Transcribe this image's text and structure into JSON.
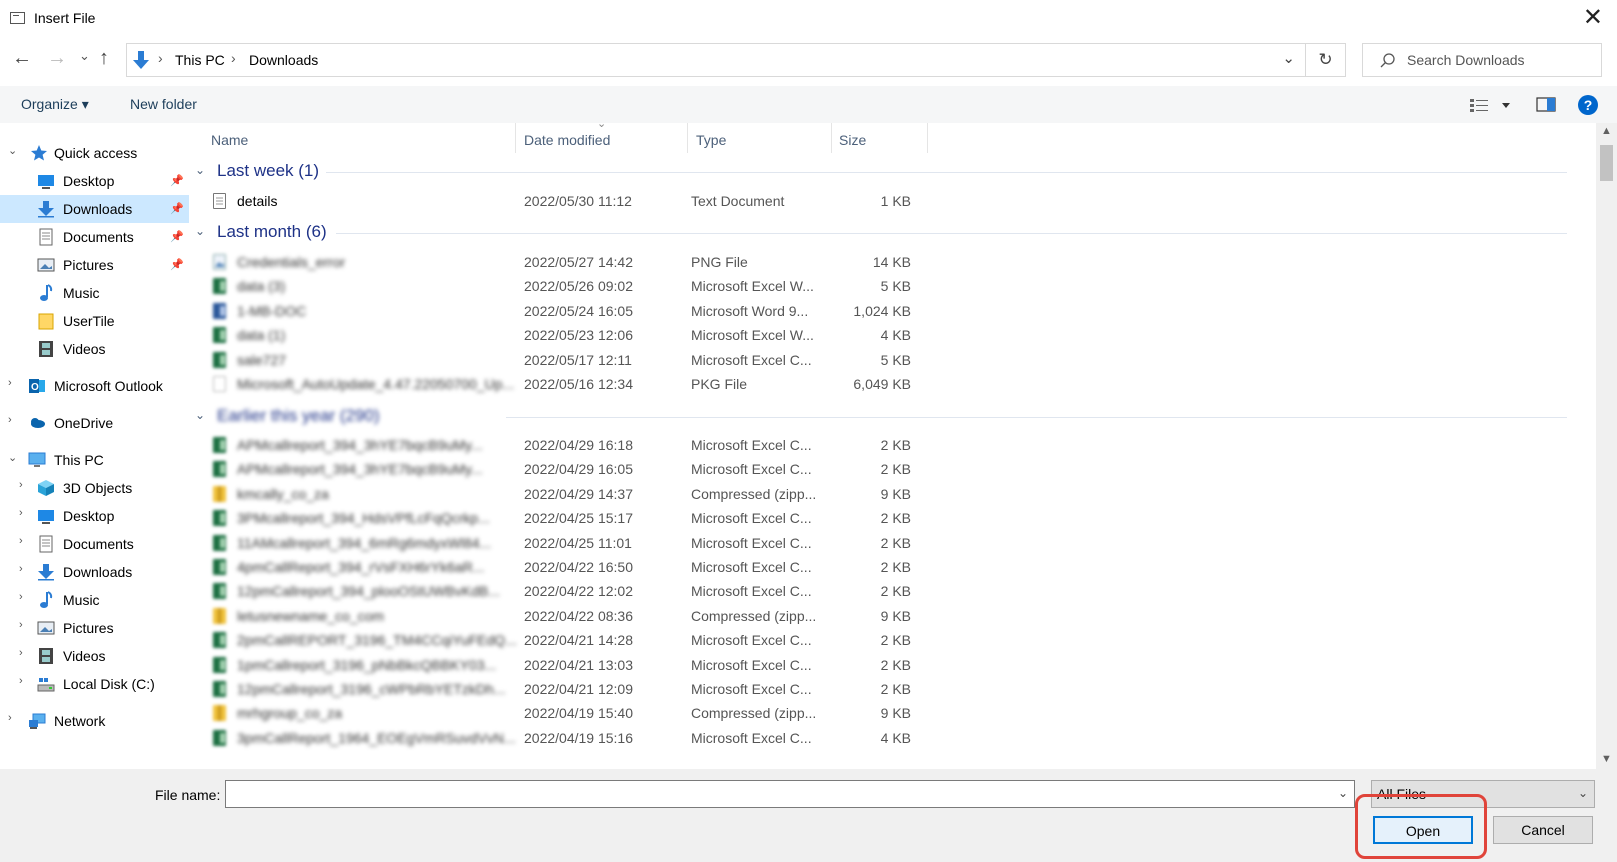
{
  "window": {
    "title": "Insert File",
    "close_glyph": "✕"
  },
  "address": {
    "back_glyph": "←",
    "forward_glyph": "→",
    "recent_glyph": "⌄",
    "up_glyph": "↑",
    "breadcrumb": [
      "This PC",
      "Downloads"
    ],
    "separator": "›",
    "dropdown_glyph": "⌄",
    "refresh_glyph": "↻"
  },
  "search": {
    "placeholder": "Search Downloads"
  },
  "toolbar": {
    "organize_label": "Organize ▾",
    "new_folder_label": "New folder",
    "help_glyph": "?"
  },
  "sidebar": {
    "items": [
      {
        "label": "Quick access",
        "icon": "star-icon"
      },
      {
        "label": "Desktop",
        "icon": "desktop-icon"
      },
      {
        "label": "Downloads",
        "icon": "download-icon"
      },
      {
        "label": "Documents",
        "icon": "documents-icon"
      },
      {
        "label": "Pictures",
        "icon": "pictures-icon"
      },
      {
        "label": "Music",
        "icon": "music-icon"
      },
      {
        "label": "UserTile",
        "icon": "folder-icon"
      },
      {
        "label": "Videos",
        "icon": "videos-icon"
      },
      {
        "label": "Microsoft Outlook",
        "icon": "outlook-icon"
      },
      {
        "label": "OneDrive",
        "icon": "cloud-icon"
      },
      {
        "label": "This PC",
        "icon": "computer-icon"
      },
      {
        "label": "3D Objects",
        "icon": "cube-icon"
      },
      {
        "label": "Desktop",
        "icon": "desktop-icon"
      },
      {
        "label": "Documents",
        "icon": "documents-icon"
      },
      {
        "label": "Downloads",
        "icon": "download-icon"
      },
      {
        "label": "Music",
        "icon": "music-icon"
      },
      {
        "label": "Pictures",
        "icon": "pictures-icon"
      },
      {
        "label": "Videos",
        "icon": "videos-icon"
      },
      {
        "label": "Local Disk (C:)",
        "icon": "drive-icon"
      },
      {
        "label": "Network",
        "icon": "network-icon"
      }
    ]
  },
  "columns": {
    "name": "Name",
    "date": "Date modified",
    "type": "Type",
    "size": "Size"
  },
  "groups": {
    "last_week": "Last week (1)",
    "last_month": "Last month (6)",
    "earlier": "Earlier this year (290)"
  },
  "files": {
    "last_week": [
      {
        "name": "details",
        "date": "2022/05/30 11:12",
        "type": "Text Document",
        "size": "1 KB",
        "icon": "text-file-icon"
      }
    ],
    "last_month": [
      {
        "name": "Credentials_error",
        "date": "2022/05/27 14:42",
        "type": "PNG File",
        "size": "14 KB",
        "icon": "image-file-icon"
      },
      {
        "name": "data (3)",
        "date": "2022/05/26 09:02",
        "type": "Microsoft Excel W...",
        "size": "5 KB",
        "icon": "excel-file-icon"
      },
      {
        "name": "1-MB-DOC",
        "date": "2022/05/24 16:05",
        "type": "Microsoft Word 9...",
        "size": "1,024 KB",
        "icon": "word-file-icon"
      },
      {
        "name": "data (1)",
        "date": "2022/05/23 12:06",
        "type": "Microsoft Excel W...",
        "size": "4 KB",
        "icon": "excel-file-icon"
      },
      {
        "name": "sale727",
        "date": "2022/05/17 12:11",
        "type": "Microsoft Excel C...",
        "size": "5 KB",
        "icon": "excel-file-icon"
      },
      {
        "name": "Microsoft_AutoUpdate_4.47.22050700_Up...",
        "date": "2022/05/16 12:34",
        "type": "PKG File",
        "size": "6,049 KB",
        "icon": "generic-file-icon"
      }
    ],
    "earlier": [
      {
        "name": "APMcallreport_394_3hYE7bqcB9uMy...",
        "date": "2022/04/29 16:18",
        "type": "Microsoft Excel C...",
        "size": "2 KB",
        "icon": "excel-file-icon"
      },
      {
        "name": "APMcallreport_394_3hYE7bqcB9uMy...",
        "date": "2022/04/29 16:05",
        "type": "Microsoft Excel C...",
        "size": "2 KB",
        "icon": "excel-file-icon"
      },
      {
        "name": "kmcally_co_za",
        "date": "2022/04/29 14:37",
        "type": "Compressed (zipp...",
        "size": "9 KB",
        "icon": "zip-file-icon"
      },
      {
        "name": "3PMcallreport_394_HdsVPfLcFqQcrkp...",
        "date": "2022/04/25 15:17",
        "type": "Microsoft Excel C...",
        "size": "2 KB",
        "icon": "excel-file-icon"
      },
      {
        "name": "11AMcallreport_394_6mRg6mdyxWl84...",
        "date": "2022/04/25 11:01",
        "type": "Microsoft Excel C...",
        "size": "2 KB",
        "icon": "excel-file-icon"
      },
      {
        "name": "4pmCallReport_394_rVsFXH6rYk6aR...",
        "date": "2022/04/22 16:50",
        "type": "Microsoft Excel C...",
        "size": "2 KB",
        "icon": "excel-file-icon"
      },
      {
        "name": "12pmCallreport_394_plooOStUWBvKdB...",
        "date": "2022/04/22 12:02",
        "type": "Microsoft Excel C...",
        "size": "2 KB",
        "icon": "excel-file-icon"
      },
      {
        "name": "letusnewname_co_com",
        "date": "2022/04/22 08:36",
        "type": "Compressed (zipp...",
        "size": "9 KB",
        "icon": "zip-file-icon"
      },
      {
        "name": "2pmCallREPORT_3196_TM4CCqiYuFEdQ...",
        "date": "2022/04/21 14:28",
        "type": "Microsoft Excel C...",
        "size": "2 KB",
        "icon": "excel-file-icon"
      },
      {
        "name": "1pmCallreport_3196_pNbBkcQBBKY03...",
        "date": "2022/04/21 13:03",
        "type": "Microsoft Excel C...",
        "size": "2 KB",
        "icon": "excel-file-icon"
      },
      {
        "name": "12pmCallreport_3196_cWPbRbYETzkDh...",
        "date": "2022/04/21 12:09",
        "type": "Microsoft Excel C...",
        "size": "2 KB",
        "icon": "excel-file-icon"
      },
      {
        "name": "mrhgroup_co_za",
        "date": "2022/04/19 15:40",
        "type": "Compressed (zipp...",
        "size": "9 KB",
        "icon": "zip-file-icon"
      },
      {
        "name": "3pmCallReport_1964_EOEgVmRSuvdVvN...",
        "date": "2022/04/19 15:16",
        "type": "Microsoft Excel C...",
        "size": "4 KB",
        "icon": "excel-file-icon"
      }
    ]
  },
  "bottom": {
    "filename_label": "File name:",
    "filename_value": "",
    "filter_value": "All Files",
    "open_label": "Open",
    "cancel_label": "Cancel"
  },
  "colors": {
    "accent": "#0078d7",
    "selection": "#cce8ff",
    "highlight_box": "#e0443a",
    "group_header": "#1e3287"
  }
}
